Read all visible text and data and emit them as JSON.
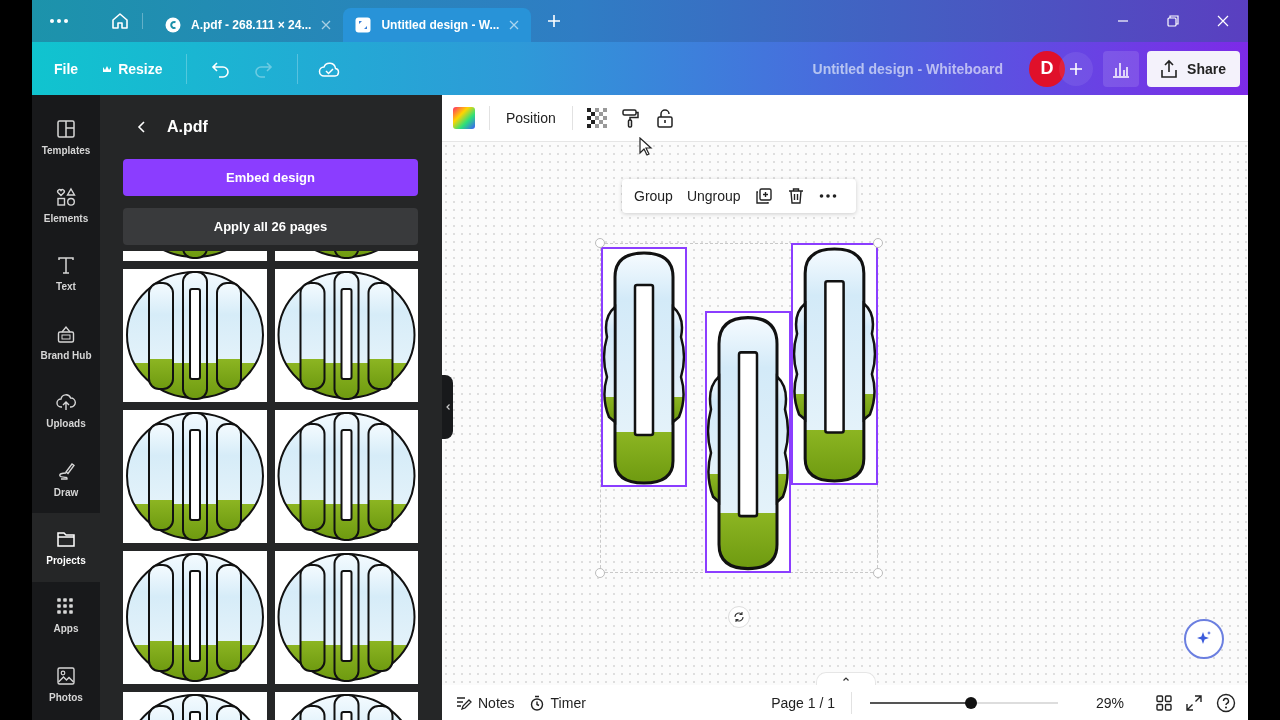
{
  "browser": {
    "tabs": [
      {
        "label": "A.pdf - 268.111 × 24...",
        "kind": "pdf",
        "selected": false
      },
      {
        "label": "Untitled design - W...",
        "kind": "design",
        "selected": true
      }
    ]
  },
  "toolbar": {
    "file": "File",
    "resize": "Resize",
    "design_title": "Untitled design - Whiteboard",
    "avatar": "D",
    "share": "Share"
  },
  "sidebar": {
    "items": [
      {
        "label": "Templates",
        "kind": "templates",
        "selected": false
      },
      {
        "label": "Elements",
        "kind": "elements",
        "selected": false
      },
      {
        "label": "Text",
        "kind": "text",
        "selected": false
      },
      {
        "label": "Brand Hub",
        "kind": "brand",
        "selected": false
      },
      {
        "label": "Uploads",
        "kind": "uploads",
        "selected": false
      },
      {
        "label": "Draw",
        "kind": "draw",
        "selected": false
      },
      {
        "label": "Projects",
        "kind": "projects",
        "selected": true
      },
      {
        "label": "Apps",
        "kind": "apps",
        "selected": false
      },
      {
        "label": "Photos",
        "kind": "photos",
        "selected": false
      }
    ]
  },
  "panel": {
    "title": "A.pdf",
    "embed_button": "Embed design",
    "apply_button": "Apply all 26 pages"
  },
  "editor": {
    "context_toolbar": {
      "position": "Position"
    },
    "element_menu": {
      "group": "Group",
      "ungroup": "Ungroup"
    },
    "footer": {
      "notes": "Notes",
      "timer": "Timer",
      "page": "Page 1 / 1",
      "zoom": {
        "level": 0.54
      },
      "zoom_reading": "29%"
    }
  }
}
